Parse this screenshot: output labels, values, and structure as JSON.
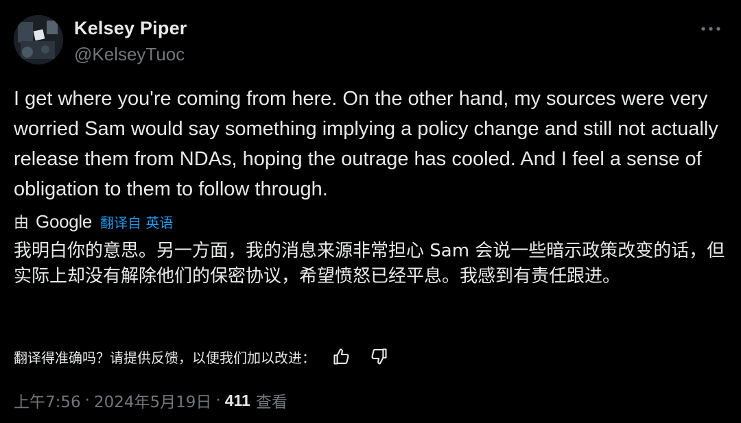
{
  "author": {
    "name": "Kelsey Piper",
    "handle": "@KelseyTuoc",
    "avatar_icon": "profile-photo"
  },
  "more_icon": "more-horizontal-icon",
  "tweet": {
    "text": "I get where you're coming from here. On the other hand, my sources were very worried Sam would say something implying a policy change and still not actually release them from NDAs, hoping the outrage has cooled. And I feel a sense of obligation to them to follow through."
  },
  "translation": {
    "by_label": "由",
    "provider": "Google",
    "link_text": "翻译自 英语",
    "text": "我明白你的意思。另一方面，我的消息来源非常担心 Sam 会说一些暗示政策改变的话，但实际上却没有解除他们的保密协议，希望愤怒已经平息。我感到有责任跟进。",
    "feedback_prompt": "翻译得准确吗？请提供反馈，以便我们加以改进：",
    "thumbs_up_icon": "thumbs-up-icon",
    "thumbs_down_icon": "thumbs-down-icon"
  },
  "meta": {
    "time": "上午7:56",
    "separator": "·",
    "date": "2024年5月19日",
    "views_count": "411",
    "views_label": "查看"
  },
  "colors": {
    "background": "#000000",
    "text_primary": "#e7e9ea",
    "text_secondary": "#71767b",
    "link": "#1d9bf0"
  }
}
